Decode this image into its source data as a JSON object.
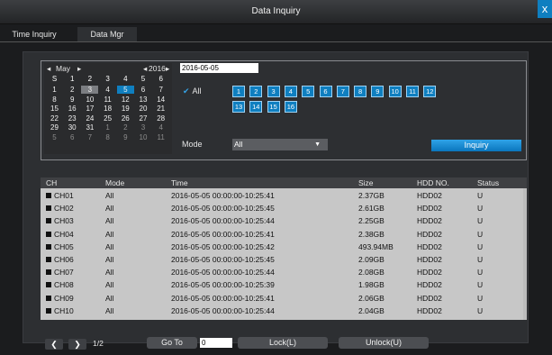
{
  "window": {
    "title": "Data Inquiry",
    "close_label": "x"
  },
  "tabs": [
    {
      "label": "Time Inquiry"
    },
    {
      "label": "Data Mgr"
    }
  ],
  "calendar": {
    "prev_month": "◂",
    "month": "May",
    "next_month": "▸",
    "prev_year": "◂",
    "year": "2016",
    "next_year": "▸",
    "weekdays": [
      "S",
      "1",
      "2",
      "3",
      "4",
      "5",
      "6"
    ],
    "rows": [
      [
        "1",
        "2",
        "3",
        "4",
        "5",
        "6",
        "7"
      ],
      [
        "8",
        "9",
        "10",
        "11",
        "12",
        "13",
        "14"
      ],
      [
        "15",
        "16",
        "17",
        "18",
        "19",
        "20",
        "21"
      ],
      [
        "22",
        "23",
        "24",
        "25",
        "26",
        "27",
        "28"
      ],
      [
        "29",
        "30",
        "31",
        "1",
        "2",
        "3",
        "4"
      ],
      [
        "5",
        "6",
        "7",
        "8",
        "9",
        "10",
        "11"
      ]
    ],
    "selected_day": "5",
    "current_day": "3"
  },
  "date_field": {
    "value": "2016-05-05"
  },
  "channels": {
    "all_label": "All",
    "all_checked": true,
    "buttons": [
      "1",
      "2",
      "3",
      "4",
      "5",
      "6",
      "7",
      "8",
      "9",
      "10",
      "11",
      "12",
      "13",
      "14",
      "15",
      "16"
    ]
  },
  "mode": {
    "label": "Mode",
    "value": "All"
  },
  "inquiry_button": "Inquiry",
  "table": {
    "headers": [
      "CH",
      "Mode",
      "Time",
      "Size",
      "HDD NO.",
      "Status"
    ],
    "rows": [
      [
        "CH01",
        "All",
        "2016-05-05 00:00:00-10:25:41",
        "2.37GB",
        "HDD02",
        "U"
      ],
      [
        "CH02",
        "All",
        "2016-05-05 00:00:00-10:25:45",
        "2.61GB",
        "HDD02",
        "U"
      ],
      [
        "CH03",
        "All",
        "2016-05-05 00:00:00-10:25:44",
        "2.25GB",
        "HDD02",
        "U"
      ],
      [
        "CH04",
        "All",
        "2016-05-05 00:00:00-10:25:41",
        "2.38GB",
        "HDD02",
        "U"
      ],
      [
        "CH05",
        "All",
        "2016-05-05 00:00:00-10:25:42",
        "493.94MB",
        "HDD02",
        "U"
      ],
      [
        "CH06",
        "All",
        "2016-05-05 00:00:00-10:25:45",
        "2.09GB",
        "HDD02",
        "U"
      ],
      [
        "CH07",
        "All",
        "2016-05-05 00:00:00-10:25:44",
        "2.08GB",
        "HDD02",
        "U"
      ],
      [
        "CH08",
        "All",
        "2016-05-05 00:00:00-10:25:39",
        "1.98GB",
        "HDD02",
        "U"
      ],
      [
        "CH09",
        "All",
        "2016-05-05 00:00:00-10:25:41",
        "2.06GB",
        "HDD02",
        "U"
      ],
      [
        "CH10",
        "All",
        "2016-05-05 00:00:00-10:25:44",
        "2.04GB",
        "HDD02",
        "U"
      ]
    ]
  },
  "footer": {
    "prev_label": "❮",
    "next_label": "❯",
    "page": "1/2",
    "goto_label": "Go To",
    "goto_value": "0",
    "lock_label": "Lock(L)",
    "unlock_label": "Unlock(U)"
  },
  "colors": {
    "accent": "#0f7fc0"
  }
}
